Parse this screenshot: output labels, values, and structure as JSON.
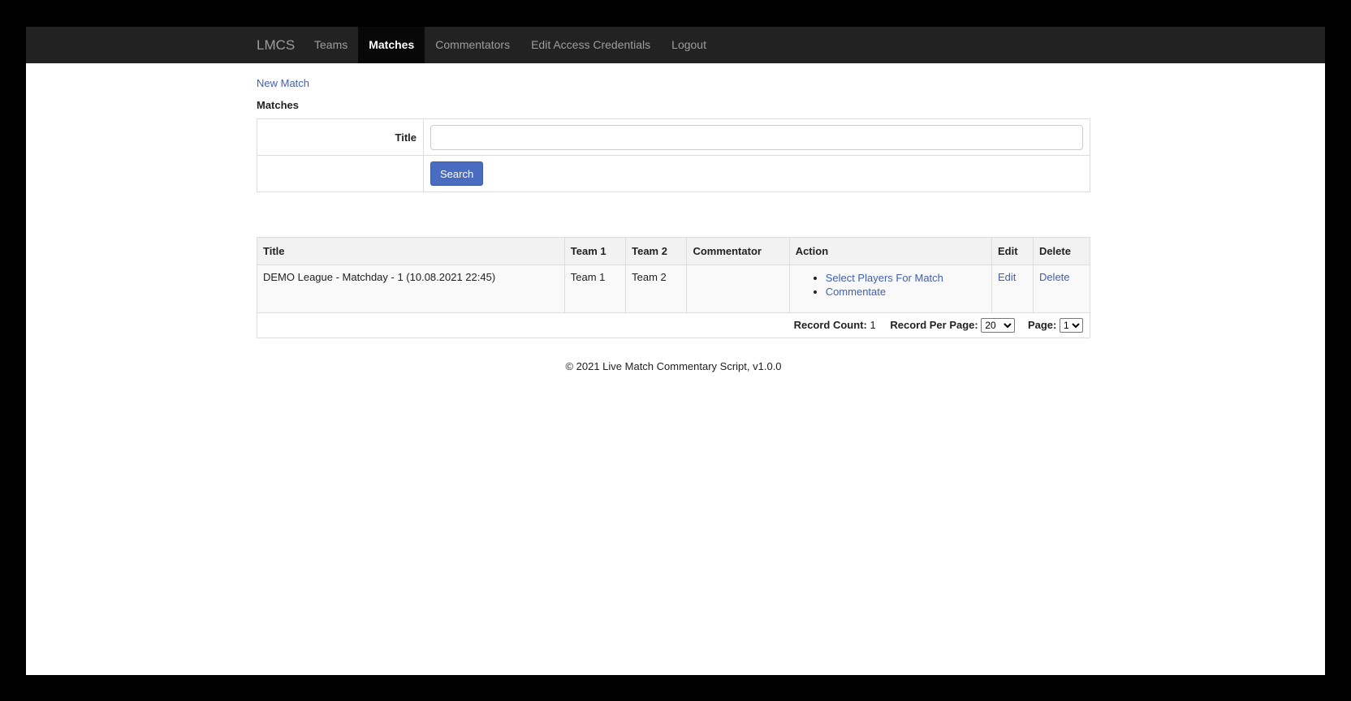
{
  "navbar": {
    "brand": "LMCS",
    "items": [
      {
        "label": "Teams",
        "active": false
      },
      {
        "label": "Matches",
        "active": true
      },
      {
        "label": "Commentators",
        "active": false
      },
      {
        "label": "Edit Access Credentials",
        "active": false
      },
      {
        "label": "Logout",
        "active": false
      }
    ]
  },
  "page": {
    "new_match_link": "New Match",
    "section_title": "Matches"
  },
  "search": {
    "title_label": "Title",
    "title_value": "",
    "title_placeholder": "",
    "button_label": "Search"
  },
  "table": {
    "headers": [
      "Title",
      "Team 1",
      "Team 2",
      "Commentator",
      "Action",
      "Edit",
      "Delete"
    ],
    "rows": [
      {
        "title": "DEMO League - Matchday - 1 (10.08.2021 22:45)",
        "team1": "Team 1",
        "team2": "Team 2",
        "commentator": "",
        "actions": [
          "Select Players For Match",
          "Commentate"
        ],
        "edit": "Edit",
        "delete": "Delete"
      }
    ]
  },
  "pager": {
    "record_count_label": "Record Count:",
    "record_count": "1",
    "per_page_label": "Record Per Page:",
    "per_page_value": "20",
    "page_label": "Page:",
    "page_value": "1"
  },
  "footer": {
    "text": "© 2021 Live Match Commentary Script, v1.0.0"
  },
  "colors": {
    "navbar_bg": "#222222",
    "link": "#4060b0",
    "button_primary": "#4a6cc0"
  }
}
